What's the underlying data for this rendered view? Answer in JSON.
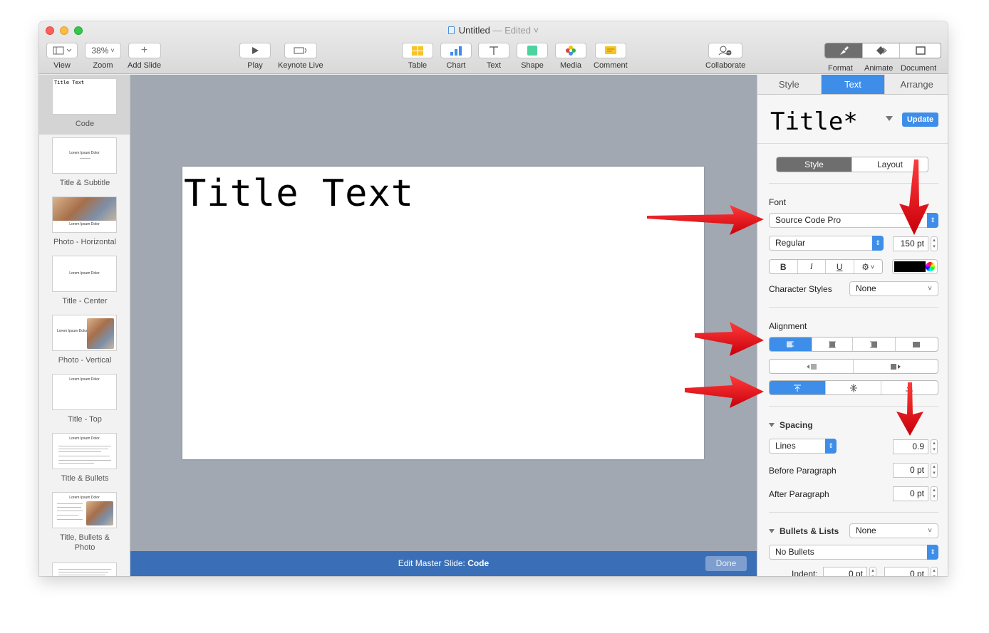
{
  "window": {
    "title": "Untitled",
    "edited_suffix": "— Edited ˅"
  },
  "toolbar": {
    "view_label": "View",
    "zoom_value": "38%",
    "zoom_label": "Zoom",
    "add_slide_label": "Add Slide",
    "play_label": "Play",
    "keynote_live_label": "Keynote Live",
    "table_label": "Table",
    "chart_label": "Chart",
    "text_label": "Text",
    "shape_label": "Shape",
    "media_label": "Media",
    "comment_label": "Comment",
    "collaborate_label": "Collaborate",
    "format_label": "Format",
    "animate_label": "Animate",
    "document_label": "Document"
  },
  "navigator": {
    "items": [
      {
        "label": "Code",
        "thumb_text": "Title Text"
      },
      {
        "label": "Title & Subtitle",
        "thumb_text": "Lorem Ipsum Dolor"
      },
      {
        "label": "Photo - Horizontal",
        "thumb_text": "Lorem Ipsum Dolor"
      },
      {
        "label": "Title - Center",
        "thumb_text": "Lorem Ipsum Dolor"
      },
      {
        "label": "Photo - Vertical",
        "thumb_text": "Lorem Ipsum Dolor"
      },
      {
        "label": "Title - Top",
        "thumb_text": "Lorem Ipsum Dolor"
      },
      {
        "label": "Title & Bullets",
        "thumb_text": "Lorem Ipsum Dolor"
      },
      {
        "label": "Title, Bullets & Photo",
        "thumb_text": "Lorem Ipsum Dolor"
      }
    ]
  },
  "slide": {
    "title_text": "Title Text"
  },
  "master_bar": {
    "prefix": "Edit Master Slide:",
    "name": "Code",
    "done_label": "Done"
  },
  "inspector": {
    "tabs": [
      "Style",
      "Text",
      "Arrange"
    ],
    "style_name": "Title*",
    "update_label": "Update",
    "subtabs": [
      "Style",
      "Layout"
    ],
    "font_heading": "Font",
    "font_family": "Source Code Pro",
    "font_typeface": "Regular",
    "font_size": "150 pt",
    "bold": "B",
    "italic": "I",
    "underline": "U",
    "text_color": "#000000",
    "character_styles_label": "Character Styles",
    "character_styles_value": "None",
    "alignment_heading": "Alignment",
    "spacing_heading": "Spacing",
    "spacing_mode": "Lines",
    "spacing_value": "0.9",
    "before_paragraph_label": "Before Paragraph",
    "before_paragraph_value": "0 pt",
    "after_paragraph_label": "After Paragraph",
    "after_paragraph_value": "0 pt",
    "bullets_heading": "Bullets & Lists",
    "bullets_value": "None",
    "bullet_type": "No Bullets",
    "indent_label": "Indent:",
    "indent_value_1": "0 pt",
    "indent_value_2": "0 pt"
  },
  "colors": {
    "accent": "#3e8ee9",
    "master_bar": "#3a6fb7",
    "canvas_bg": "#a1a8b2",
    "annotation_arrow": "#e0141e"
  }
}
